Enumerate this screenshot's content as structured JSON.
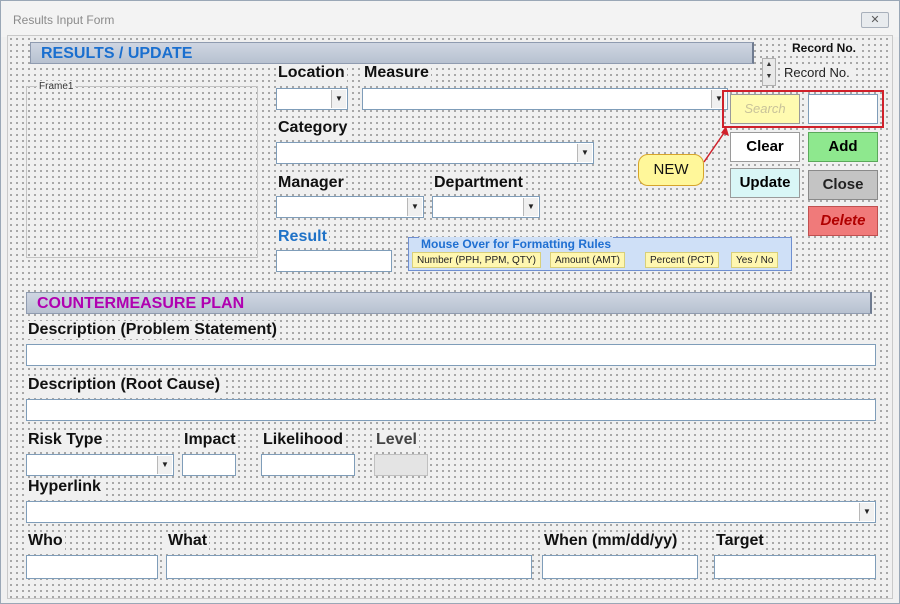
{
  "window": {
    "title": "Results Input Form",
    "close_glyph": "✕"
  },
  "header": {
    "results_banner": "RESULTS / UPDATE",
    "record_no_title": "Record No.",
    "record_no_label": "Record No."
  },
  "frame": {
    "caption": "Frame1"
  },
  "fields": {
    "location": "Location",
    "measure": "Measure",
    "category": "Category",
    "manager": "Manager",
    "department": "Department",
    "result": "Result"
  },
  "buttons": {
    "search": "Search",
    "clear": "Clear",
    "add": "Add",
    "update": "Update",
    "close": "Close",
    "delete": "Delete"
  },
  "callout": {
    "text": "NEW"
  },
  "formatting_rules": {
    "title": "Mouse Over for Formatting Rules",
    "items": [
      "Number (PPH, PPM, QTY)",
      "Amount (AMT)",
      "Percent (PCT)",
      "Yes / No"
    ]
  },
  "countermeasure": {
    "banner": "COUNTERMEASURE PLAN",
    "problem_statement": "Description (Problem Statement)",
    "root_cause": "Description (Root Cause)",
    "risk_type": "Risk Type",
    "impact": "Impact",
    "likelihood": "Likelihood",
    "level": "Level",
    "hyperlink": "Hyperlink",
    "who": "Who",
    "what": "What",
    "when": "When (mm/dd/yy)",
    "target": "Target"
  },
  "colors": {
    "banner_results_text": "#1a6fcf",
    "banner_countermeasure_text": "#b000b0",
    "add_button": "#8ee88e",
    "delete_button": "#f07a7a",
    "update_button": "#d9f6f6",
    "search_button": "#fffbb0",
    "highlight_box": "#d0202a",
    "callout_fill": "#fff79a"
  }
}
